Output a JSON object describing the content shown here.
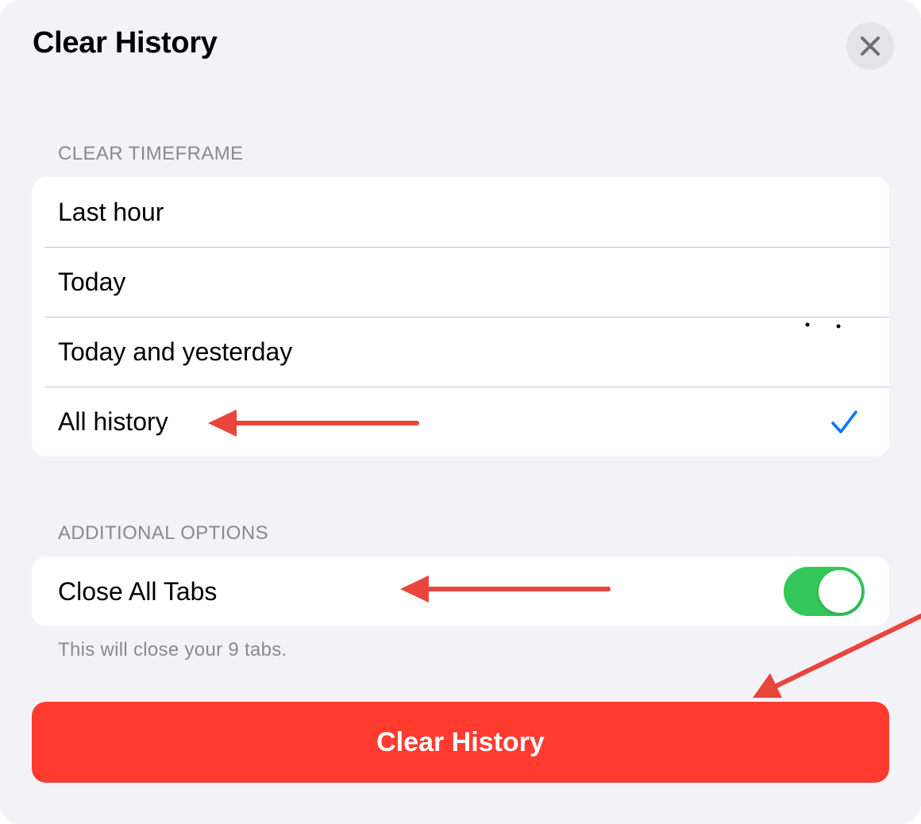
{
  "header": {
    "title": "Clear History",
    "close_icon": "close-icon"
  },
  "timeframe": {
    "section_title": "CLEAR TIMEFRAME",
    "options": [
      {
        "label": "Last hour",
        "selected": false
      },
      {
        "label": "Today",
        "selected": false
      },
      {
        "label": "Today and yesterday",
        "selected": false
      },
      {
        "label": "All history",
        "selected": true
      }
    ]
  },
  "additional": {
    "section_title": "ADDITIONAL OPTIONS",
    "close_all_tabs": {
      "label": "Close All Tabs",
      "enabled": true
    },
    "footnote": "This will close your 9 tabs."
  },
  "action": {
    "clear_label": "Clear History"
  },
  "colors": {
    "background": "#f2f2f7",
    "card": "#ffffff",
    "accent_blue": "#007aff",
    "toggle_on": "#34c759",
    "destructive": "#ff3b30",
    "annotation_arrow": "#e8453c"
  }
}
